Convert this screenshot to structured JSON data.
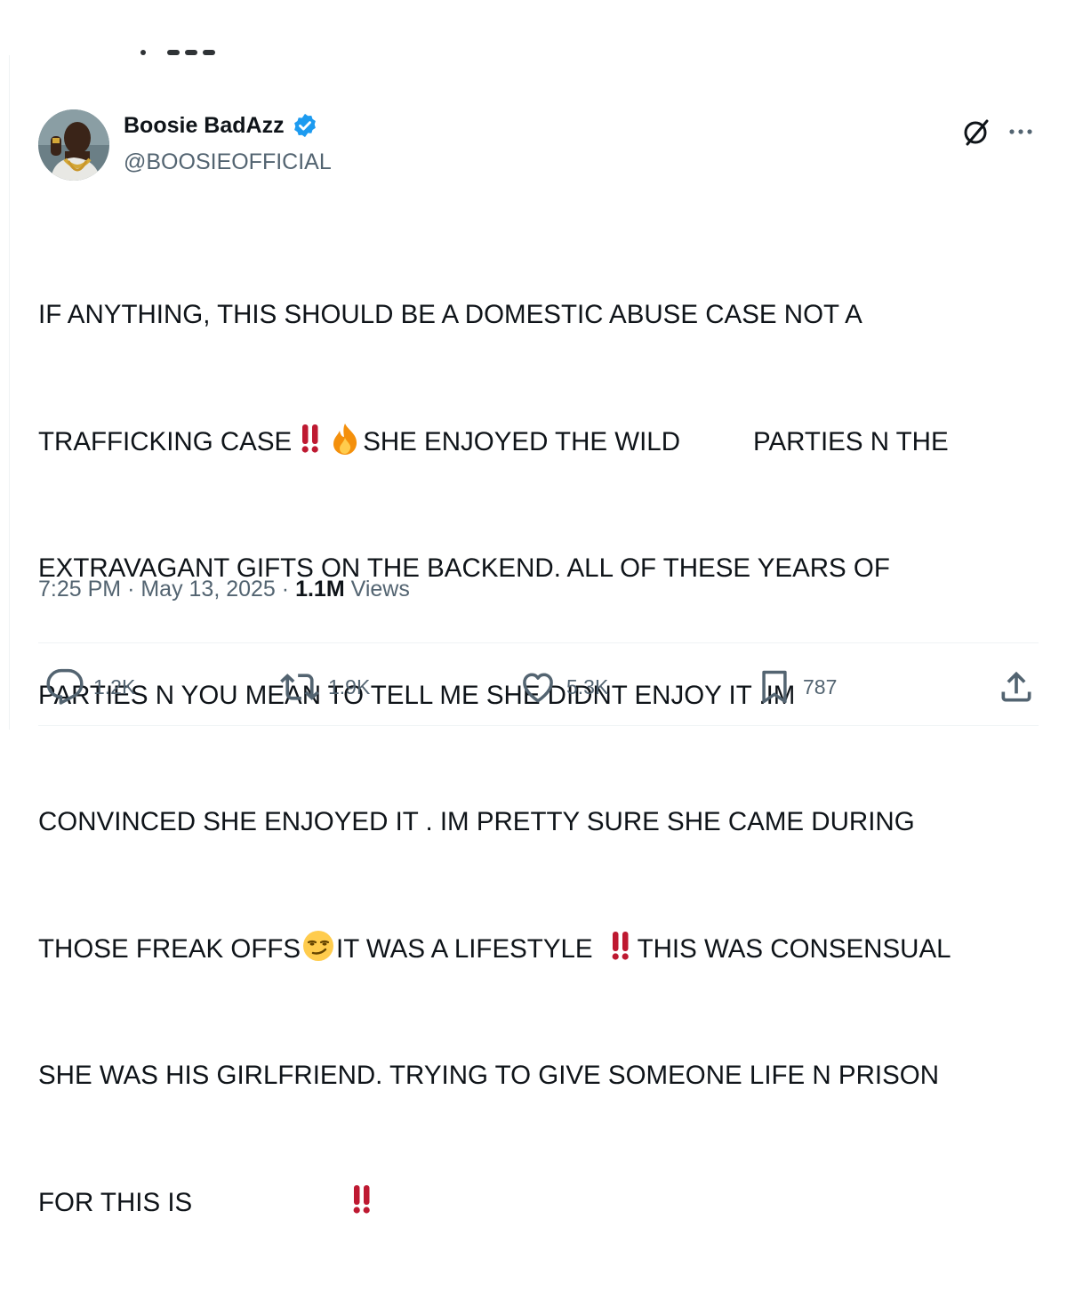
{
  "author": {
    "display_name": "Boosie BadAzz",
    "handle": "@BOOSIEOFFICIAL",
    "verified": true,
    "verified_color": "#1d9bf0"
  },
  "post": {
    "lines": [
      "IF ANYTHING, THIS SHOULD BE A DOMESTIC ABUSE CASE NOT A",
      "TRAFFICKING CASE",
      "SHE ENJOYED THE WILD",
      "PARTIES N THE",
      "EXTRAVAGANT GIFTS ON THE BACKEND. ALL OF THESE YEARS OF",
      "PARTIES N YOU MEAN TO TELL ME SHE DIDNT ENJOY IT .IM",
      "CONVINCED SHE ENJOYED IT . IM PRETTY SURE SHE CAME DURING",
      "THOSE FREAK OFFS",
      "IT WAS A LIFESTYLE",
      "THIS WAS CONSENSUAL",
      "SHE WAS HIS GIRLFRIEND. TRYING TO GIVE SOMEONE LIFE N PRISON",
      "FOR THIS IS"
    ],
    "emoji": {
      "double_exclamation": "double-exclamation-icon",
      "fire": "fire-icon",
      "smirk": "smirk-face-icon"
    }
  },
  "meta": {
    "time": "7:25 PM",
    "separator": "·",
    "date": "May 13, 2025",
    "views_count": "1.1M",
    "views_label": "Views"
  },
  "actions": {
    "replies": "1.2K",
    "reposts": "1.9K",
    "likes": "5.3K",
    "bookmarks": "787"
  },
  "colors": {
    "text": "#0f1419",
    "secondary": "#536471",
    "divider": "#eff3f4",
    "alert_red": "#be1931",
    "fire_orange": "#f4900c",
    "smirk_yellow": "#ffcc4d"
  }
}
